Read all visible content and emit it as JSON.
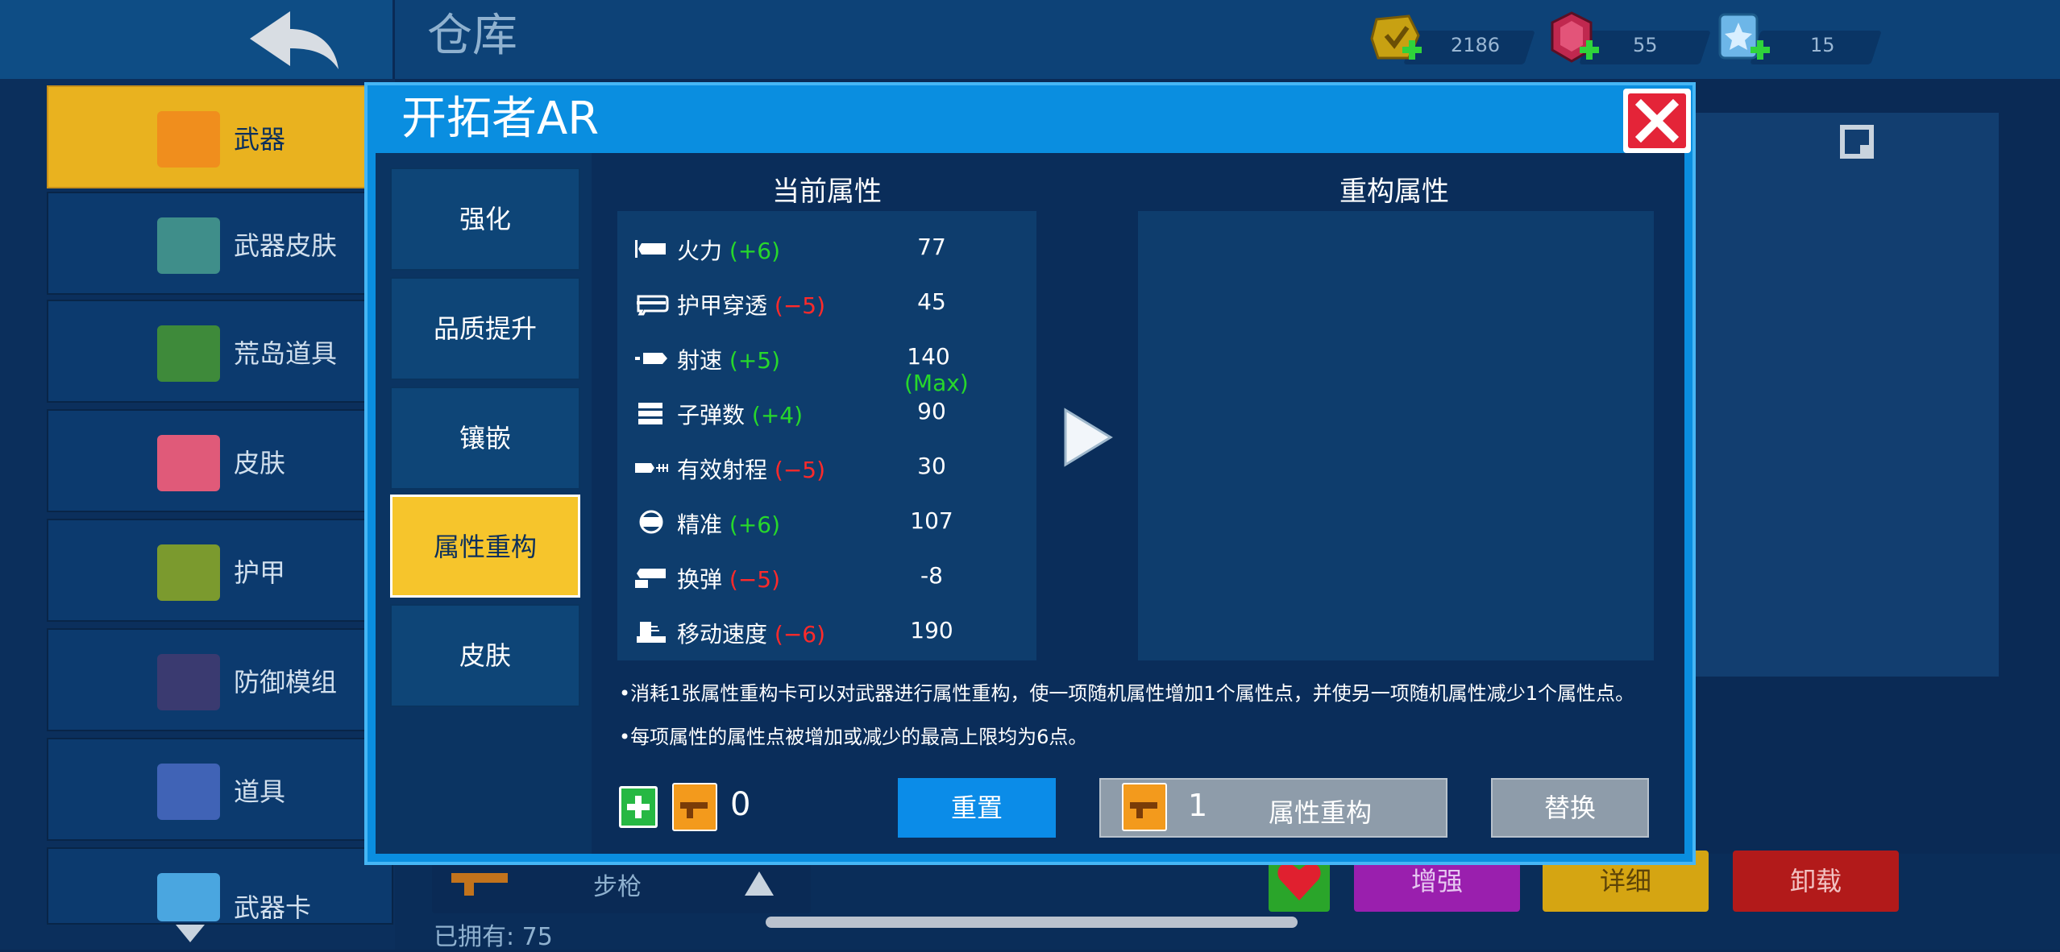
{
  "screen": {
    "title": "仓库",
    "currencies": [
      {
        "icon": "gold-coin-icon",
        "value": "2186"
      },
      {
        "icon": "gem-icon",
        "value": "55"
      },
      {
        "icon": "ticket-icon",
        "value": "15"
      }
    ],
    "sidebar": [
      {
        "label": "武器",
        "icon": "gun-icon",
        "active": true
      },
      {
        "label": "武器皮肤",
        "icon": "gun-skin-icon"
      },
      {
        "label": "荒岛道具",
        "icon": "backpack-icon"
      },
      {
        "label": "皮肤",
        "icon": "face-icon"
      },
      {
        "label": "护甲",
        "icon": "armor-vest-icon"
      },
      {
        "label": "防御模组",
        "icon": "shield-module-icon"
      },
      {
        "label": "道具",
        "icon": "chest-icon"
      },
      {
        "label": "武器卡",
        "icon": "upgrade-card-icon"
      }
    ],
    "category": "步枪",
    "owned": "已拥有: 75",
    "buttons": {
      "enhance": "增强",
      "detail": "详细",
      "unequip": "卸载"
    }
  },
  "modal": {
    "title": "开拓者AR",
    "tabs": [
      "强化",
      "品质提升",
      "镶嵌",
      "属性重构",
      "皮肤"
    ],
    "active_tab": "属性重构",
    "current_header": "当前属性",
    "new_header": "重构属性",
    "stats": [
      {
        "name": "火力",
        "delta": "(+6)",
        "sign": "pos",
        "value": "77",
        "icon": "firepower-icon"
      },
      {
        "name": "护甲穿透",
        "delta": "(−5)",
        "sign": "neg",
        "value": "45",
        "icon": "armor-pierce-icon"
      },
      {
        "name": "射速",
        "delta": "(+5)",
        "sign": "pos",
        "value": "140",
        "max": "(Max)",
        "icon": "fire-rate-icon"
      },
      {
        "name": "子弹数",
        "delta": "(+4)",
        "sign": "pos",
        "value": "90",
        "icon": "ammo-icon"
      },
      {
        "name": "有效射程",
        "delta": "(−5)",
        "sign": "neg",
        "value": "30",
        "icon": "range-icon"
      },
      {
        "name": "精准",
        "delta": "(+6)",
        "sign": "pos",
        "value": "107",
        "icon": "accuracy-icon"
      },
      {
        "name": "换弹",
        "delta": "(−5)",
        "sign": "neg",
        "value": "-8",
        "icon": "reload-icon"
      },
      {
        "name": "移动速度",
        "delta": "(−6)",
        "sign": "neg",
        "value": "190",
        "icon": "move-speed-icon"
      }
    ],
    "notes": [
      "•消耗1张属性重构卡可以对武器进行属性重构，使一项随机属性增加1个属性点，并使另一项随机属性减少1个属性点。",
      "•每项属性的属性点被增加或减少的最高上限均为6点。"
    ],
    "card_count": "0",
    "reset_label": "重置",
    "reforge_cost": "1",
    "reforge_label": "属性重构",
    "replace_label": "替换"
  },
  "colors": {
    "accent_blue": "#0a8ee0",
    "active_tab": "#f6c52c",
    "positive": "#27d82b",
    "negative": "#ff2a2a",
    "close_red": "#e42438"
  }
}
